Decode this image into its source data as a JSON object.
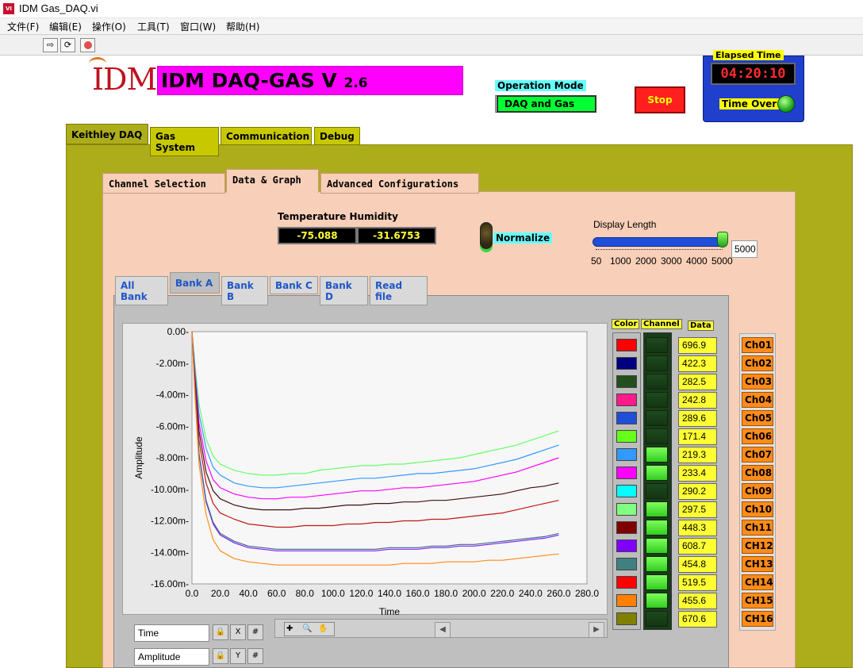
{
  "window": {
    "title": "IDM Gas_DAQ.vi"
  },
  "menu": [
    "文件(F)",
    "编辑(E)",
    "操作(O)",
    "工具(T)",
    "窗口(W)",
    "帮助(H)"
  ],
  "header": {
    "logo": "IDM",
    "title_main": "IDM DAQ-GAS",
    "title_v": "V",
    "title_ver": "2.6",
    "operation_mode_label": "Operation Mode",
    "operation_mode_value": "DAQ and Gas",
    "stop_label": "Stop",
    "elapsed_label": "Elapsed Time",
    "elapsed_value": "04:20:10",
    "time_over_label": "Time Over"
  },
  "main_tabs": [
    {
      "label": "Keithley DAQ",
      "active": true
    },
    {
      "label": "Gas System",
      "active": false
    },
    {
      "label": "Communication",
      "active": false
    },
    {
      "label": "Debug",
      "active": false
    }
  ],
  "sub_tabs": [
    {
      "label": "Channel Selection",
      "active": false
    },
    {
      "label": "Data & Graph",
      "active": true
    },
    {
      "label": "Advanced Configurations",
      "active": false
    }
  ],
  "readouts": {
    "label": "Temperature  Humidity",
    "temperature": "-75.088",
    "humidity": "-31.6753"
  },
  "normalize_label": "Normalize",
  "display_length": {
    "label": "Display Length",
    "scale": [
      "50",
      "1000",
      "2000",
      "3000",
      "4000",
      "5000"
    ],
    "value_text": "5000",
    "level": 1.0
  },
  "bank_tabs": [
    {
      "label": "All Bank",
      "active": false
    },
    {
      "label": "Bank A",
      "active": true
    },
    {
      "label": "Bank B",
      "active": false
    },
    {
      "label": "Bank C",
      "active": false
    },
    {
      "label": "Bank D",
      "active": false
    },
    {
      "label": "Read file",
      "active": false
    }
  ],
  "chart_data": {
    "type": "line",
    "title": "",
    "xlabel": "Time",
    "ylabel": "Amplitude",
    "xlim": [
      0,
      280
    ],
    "ylim": [
      -16,
      0
    ],
    "x_ticks": [
      "0.0",
      "20.0",
      "40.0",
      "60.0",
      "80.0",
      "100.0",
      "120.0",
      "140.0",
      "160.0",
      "180.0",
      "200.0",
      "220.0",
      "240.0",
      "260.0",
      "280.0"
    ],
    "y_ticks": [
      "0.00-",
      "-2.00m-",
      "-4.00m-",
      "-6.00m-",
      "-8.00m-",
      "-10.00m-",
      "-12.00m-",
      "-14.00m-",
      "-16.00m-"
    ],
    "y_tick_values": [
      0,
      -2,
      -4,
      -6,
      -8,
      -10,
      -12,
      -14,
      -16
    ],
    "x": [
      0,
      2,
      5,
      10,
      15,
      20,
      30,
      40,
      50,
      60,
      70,
      80,
      90,
      100,
      110,
      120,
      130,
      140,
      150,
      160,
      170,
      180,
      190,
      200,
      210,
      220,
      230,
      240,
      250,
      260
    ],
    "series": [
      {
        "color": "#66ff66",
        "values": [
          0,
          -2.0,
          -4.6,
          -6.8,
          -7.9,
          -8.4,
          -8.8,
          -9.0,
          -9.1,
          -9.1,
          -9.0,
          -9.0,
          -8.8,
          -8.7,
          -8.6,
          -8.5,
          -8.5,
          -8.4,
          -8.4,
          -8.3,
          -8.2,
          -8.1,
          -8.0,
          -7.8,
          -7.6,
          -7.4,
          -7.2,
          -6.9,
          -6.6,
          -6.3
        ]
      },
      {
        "color": "#3399ff",
        "values": [
          0,
          -2.3,
          -5.2,
          -7.4,
          -8.6,
          -9.1,
          -9.6,
          -9.8,
          -9.9,
          -9.9,
          -9.8,
          -9.7,
          -9.6,
          -9.5,
          -9.4,
          -9.3,
          -9.3,
          -9.2,
          -9.1,
          -9.0,
          -9.0,
          -8.9,
          -8.8,
          -8.7,
          -8.5,
          -8.3,
          -8.1,
          -7.8,
          -7.5,
          -7.2
        ]
      },
      {
        "color": "#ff00ff",
        "values": [
          0,
          -2.6,
          -5.8,
          -8.2,
          -9.4,
          -9.9,
          -10.3,
          -10.5,
          -10.6,
          -10.6,
          -10.5,
          -10.5,
          -10.4,
          -10.3,
          -10.2,
          -10.1,
          -10.1,
          -10.0,
          -9.9,
          -9.9,
          -9.8,
          -9.7,
          -9.6,
          -9.5,
          -9.3,
          -9.1,
          -8.9,
          -8.6,
          -8.3,
          -8.0
        ]
      },
      {
        "color": "#401010",
        "values": [
          0,
          -2.9,
          -6.3,
          -8.9,
          -10.1,
          -10.6,
          -11.0,
          -11.2,
          -11.3,
          -11.3,
          -11.3,
          -11.2,
          -11.2,
          -11.1,
          -11.0,
          -11.0,
          -10.9,
          -10.9,
          -10.8,
          -10.8,
          -10.7,
          -10.7,
          -10.6,
          -10.5,
          -10.4,
          -10.3,
          -10.1,
          -9.9,
          -9.8,
          -9.6
        ]
      },
      {
        "color": "#c01818",
        "values": [
          0,
          -3.2,
          -6.9,
          -9.6,
          -10.9,
          -11.5,
          -11.9,
          -12.2,
          -12.3,
          -12.4,
          -12.4,
          -12.3,
          -12.3,
          -12.3,
          -12.2,
          -12.2,
          -12.1,
          -12.1,
          -12.0,
          -12.0,
          -11.9,
          -11.9,
          -11.8,
          -11.7,
          -11.6,
          -11.5,
          -11.3,
          -11.1,
          -10.9,
          -10.7
        ]
      },
      {
        "color": "#7722ff",
        "values": [
          0,
          -3.6,
          -7.8,
          -10.8,
          -12.2,
          -12.9,
          -13.4,
          -13.7,
          -13.8,
          -13.9,
          -13.9,
          -13.9,
          -13.9,
          -13.9,
          -13.9,
          -13.9,
          -13.9,
          -13.8,
          -13.8,
          -13.8,
          -13.7,
          -13.7,
          -13.6,
          -13.6,
          -13.5,
          -13.4,
          -13.3,
          -13.2,
          -13.1,
          -12.9
        ]
      },
      {
        "color": "#446688",
        "values": [
          0,
          -3.6,
          -7.7,
          -10.7,
          -12.1,
          -12.8,
          -13.3,
          -13.6,
          -13.7,
          -13.8,
          -13.8,
          -13.8,
          -13.8,
          -13.8,
          -13.8,
          -13.8,
          -13.8,
          -13.7,
          -13.7,
          -13.7,
          -13.6,
          -13.6,
          -13.5,
          -13.5,
          -13.4,
          -13.3,
          -13.2,
          -13.1,
          -13.0,
          -12.8
        ]
      },
      {
        "color": "#ff8c1a",
        "values": [
          0,
          -3.9,
          -8.4,
          -11.6,
          -13.2,
          -13.9,
          -14.4,
          -14.6,
          -14.7,
          -14.8,
          -14.8,
          -14.8,
          -14.8,
          -14.8,
          -14.8,
          -14.8,
          -14.8,
          -14.8,
          -14.7,
          -14.7,
          -14.7,
          -14.6,
          -14.6,
          -14.6,
          -14.5,
          -14.5,
          -14.4,
          -14.3,
          -14.2,
          -14.1
        ]
      }
    ]
  },
  "legend": {
    "x_name": "Time",
    "y_name": "Amplitude"
  },
  "table": {
    "color_header": "Color",
    "channel_header": "Channel",
    "data_header": "Data",
    "rows": [
      {
        "color": "#ff0000",
        "on": false,
        "value": "696.9",
        "label": "Ch01"
      },
      {
        "color": "#000080",
        "on": false,
        "value": "422.3",
        "label": "Ch02"
      },
      {
        "color": "#234f1e",
        "on": false,
        "value": "282.5",
        "label": "Ch03"
      },
      {
        "color": "#ff1a8c",
        "on": false,
        "value": "242.8",
        "label": "Ch04"
      },
      {
        "color": "#1f4ed8",
        "on": false,
        "value": "289.6",
        "label": "Ch05"
      },
      {
        "color": "#66ff1a",
        "on": false,
        "value": "171.4",
        "label": "Ch06"
      },
      {
        "color": "#3399ff",
        "on": true,
        "value": "219.3",
        "label": "Ch07"
      },
      {
        "color": "#ff00ff",
        "on": true,
        "value": "233.4",
        "label": "Ch08"
      },
      {
        "color": "#00ffff",
        "on": false,
        "value": "290.2",
        "label": "Ch09"
      },
      {
        "color": "#80ff80",
        "on": true,
        "value": "297.5",
        "label": "Ch10"
      },
      {
        "color": "#800000",
        "on": true,
        "value": "448.3",
        "label": "Ch11"
      },
      {
        "color": "#8000ff",
        "on": true,
        "value": "608.7",
        "label": "CH12"
      },
      {
        "color": "#408080",
        "on": true,
        "value": "454.8",
        "label": "CH13"
      },
      {
        "color": "#ff0000",
        "on": true,
        "value": "519.5",
        "label": "CH14"
      },
      {
        "color": "#ff8000",
        "on": true,
        "value": "455.6",
        "label": "CH15"
      },
      {
        "color": "#808000",
        "on": false,
        "value": "670.6",
        "label": "CH16"
      }
    ]
  }
}
